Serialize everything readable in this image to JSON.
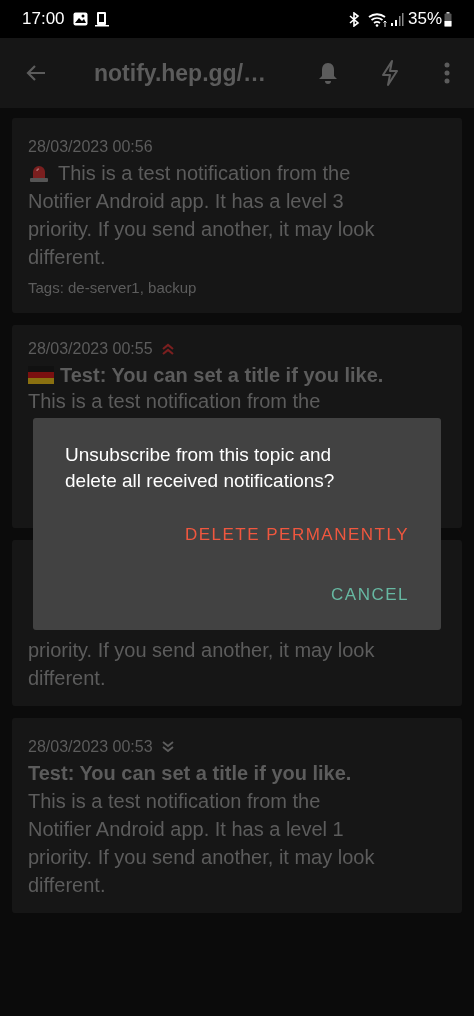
{
  "status_bar": {
    "time": "17:00",
    "battery": "35%"
  },
  "app_bar": {
    "title": "notify.hep.gg/…"
  },
  "notifications": [
    {
      "kind": "full",
      "time": "28/03/2023 00:56",
      "prefix": {
        "kind": "siren"
      },
      "body_lines": [
        "This is a test notification from the",
        "Notifier Android app. It has a level 3",
        "priority. If you send another, it may look",
        "different."
      ],
      "tags": "Tags: de-server1, backup"
    },
    {
      "kind": "covered_bottom",
      "time": "28/03/2023 00:55",
      "priority_mark": {
        "kind": "up"
      },
      "prefix": {
        "kind": "flag"
      },
      "title": "Test: You can set a title if you like.",
      "body_lines": [
        "This is a test notification from the"
      ]
    },
    {
      "kind": "covered_top",
      "body_lines": [
        "priority. If you send another, it may look",
        "different."
      ]
    },
    {
      "kind": "full",
      "time": "28/03/2023 00:53",
      "priority_mark": {
        "kind": "down"
      },
      "title": "Test: You can set a title if you like.",
      "body_lines": [
        "This is a test notification from the",
        "Notifier Android app. It has a level 1",
        "priority. If you send another, it may look",
        "different."
      ]
    }
  ],
  "dialog": {
    "message": "Unsubscribe from this topic and delete all received notifications?",
    "buttons": [
      {
        "label": "DELETE PERMANENTLY",
        "kind": "destructive"
      },
      {
        "label": "CANCEL",
        "kind": "neutral"
      }
    ]
  }
}
